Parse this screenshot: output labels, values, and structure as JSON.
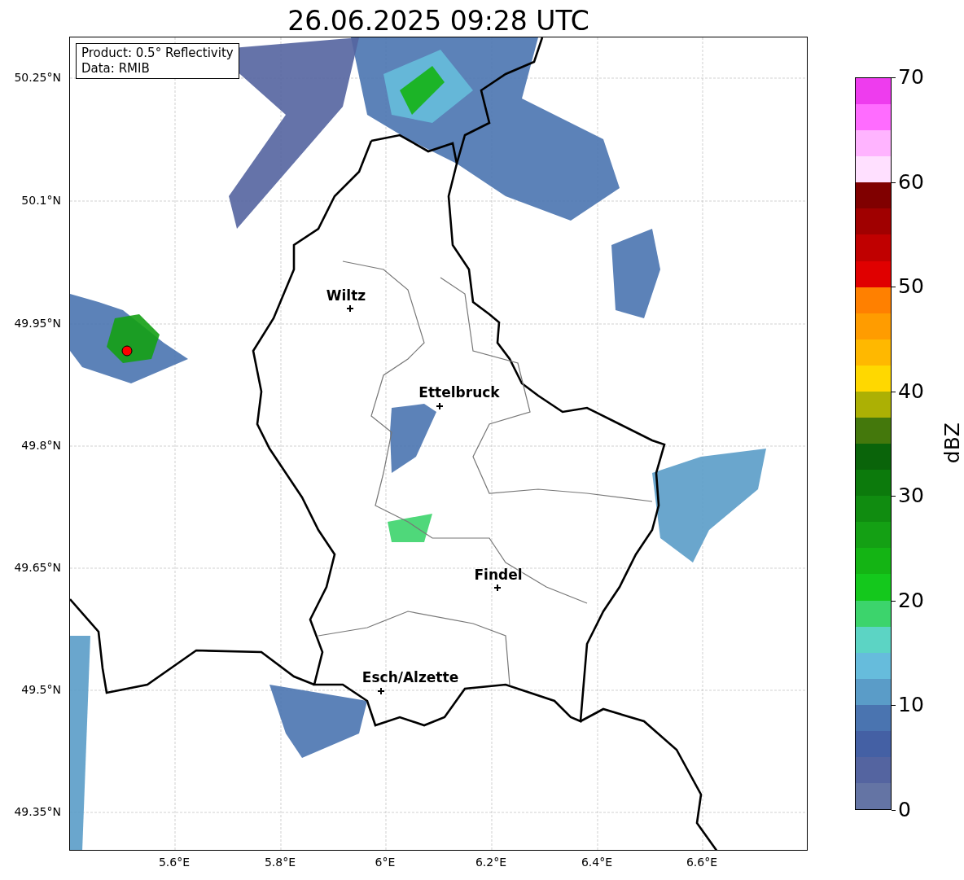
{
  "title": "26.06.2025 09:28 UTC",
  "info_box": [
    "Product: 0.5° Reflectivity",
    "Data: RMIB"
  ],
  "cities": [
    {
      "name": "Wiltz"
    },
    {
      "name": "Ettelbruck"
    },
    {
      "name": "Findel"
    },
    {
      "name": "Esch/Alzette"
    }
  ],
  "lat_ticks": [
    "50.25°N",
    "50.1°N",
    "49.95°N",
    "49.8°N",
    "49.65°N",
    "49.5°N",
    "49.35°N"
  ],
  "lon_ticks": [
    "5.6°E",
    "5.8°E",
    "6°E",
    "6.2°E",
    "6.4°E",
    "6.6°E"
  ],
  "colorbar": {
    "label": "dBZ",
    "ticks": [
      "70",
      "60",
      "50",
      "40",
      "30",
      "20",
      "10",
      "0"
    ],
    "segments": [
      {
        "color": "#ee3cee"
      },
      {
        "color": "#ff6cff"
      },
      {
        "color": "#ffb4ff"
      },
      {
        "color": "#ffe0ff"
      },
      {
        "color": "#800000"
      },
      {
        "color": "#a00000"
      },
      {
        "color": "#c00000"
      },
      {
        "color": "#e00000"
      },
      {
        "color": "#ff8000"
      },
      {
        "color": "#ff9c00"
      },
      {
        "color": "#ffb800"
      },
      {
        "color": "#ffd800"
      },
      {
        "color": "#acb004"
      },
      {
        "color": "#44780c"
      },
      {
        "color": "#0a640a"
      },
      {
        "color": "#0c7a0c"
      },
      {
        "color": "#108c10"
      },
      {
        "color": "#14a014"
      },
      {
        "color": "#14b414"
      },
      {
        "color": "#14c81c"
      },
      {
        "color": "#3cd46c"
      },
      {
        "color": "#5cd4c4"
      },
      {
        "color": "#66bcdc"
      },
      {
        "color": "#5a9cc8"
      },
      {
        "color": "#4a74b0"
      },
      {
        "color": "#4460a4"
      },
      {
        "color": "#5464a0"
      },
      {
        "color": "#6474a4"
      }
    ]
  }
}
